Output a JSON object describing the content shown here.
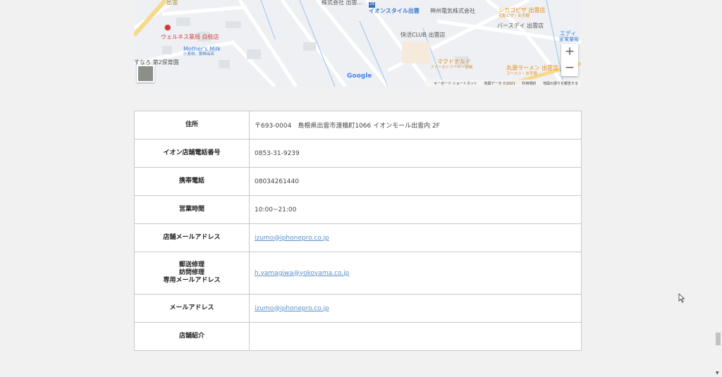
{
  "map": {
    "labels": {
      "company_top": "株式会社 出雲…",
      "aeon_style": "イオンスタイル出雲",
      "shinshu": "神州電気株式会社",
      "shikago": "シカゴピザ 出雲店",
      "shikago_sub": "宅配ピザ・お手軽",
      "birthday": "バースデイ 出雲店",
      "edion": "エディ",
      "edion_sub": "家電量販",
      "wellness": "ウェルネス薬局 白枝店",
      "mothers": "Mother's Milk",
      "mothers_sub": "小麦粉、服飾品店",
      "kaikatsu": "快活CLUB 出雲店",
      "mcd": "マクドナルド",
      "mcd_sub": "ファーストフード・安価",
      "maru": "丸源ラーメン 出雲店",
      "maru_sub": "ラーメン・お手頃",
      "hoikuen": "すなろ 第2保育園",
      "route": "28",
      "road": "出雲"
    },
    "google": "Google",
    "zoom_in": "+",
    "zoom_out": "−",
    "attribution": [
      "キーボード ショートカット",
      "地図データ ©2021",
      "利用規約",
      "地図の誤りを報告する"
    ]
  },
  "table": {
    "rows": [
      {
        "label": "住所",
        "value": "〒693-0004　島根県出雲市渡橋町1066 イオンモール出雲内 2F"
      },
      {
        "label": "イオン店舗電話番号",
        "value": "0853-31-9239"
      },
      {
        "label": "携帯電話",
        "value": "08034261440"
      },
      {
        "label": "営業時間",
        "value": "10:00~21:00"
      },
      {
        "label": "店舗メールアドレス",
        "value": "izumo@iphonepro.co.jp",
        "link": true
      },
      {
        "label_lines": [
          "郵送修理",
          "訪問修理",
          "専用メールアドレス"
        ],
        "value": "h.yamagiwa@yokoyama.co.jp",
        "link": true
      },
      {
        "label": "メールアドレス",
        "value": "izumo@iphonepro.co.jp",
        "link": true
      },
      {
        "label": "店舗紹介",
        "value": ""
      }
    ]
  }
}
